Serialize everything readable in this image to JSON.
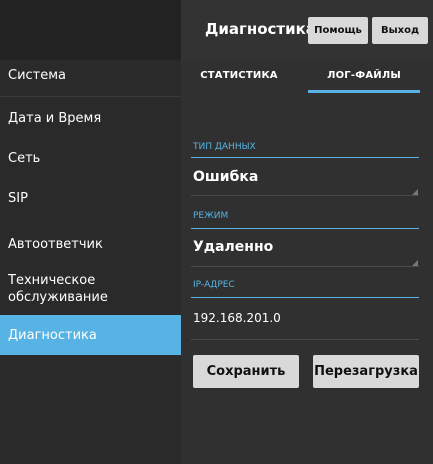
{
  "header": {
    "title": "Диагностика",
    "help_label": "Помощь",
    "exit_label": "Выход"
  },
  "sidebar": {
    "items": [
      {
        "label": "Система"
      },
      {
        "label": "Дата и Время"
      },
      {
        "label": "Сеть"
      },
      {
        "label": "SIP"
      },
      {
        "label": "Автоответчик"
      },
      {
        "label": "Техническое обслуживание"
      },
      {
        "label": "Диагностика",
        "selected": true
      }
    ]
  },
  "tabs": [
    {
      "label": "СТАТИСТИКА"
    },
    {
      "label": "ЛОГ-ФАЙЛЫ",
      "active": true
    }
  ],
  "form": {
    "data_type": {
      "label": "ТИП ДАННЫХ",
      "value": "Ошибка"
    },
    "mode": {
      "label": "РЕЖИМ",
      "value": "Удаленно"
    },
    "ip": {
      "label": "IP-АДРЕС",
      "value": "192.168.201.0"
    }
  },
  "actions": {
    "save_label": "Сохранить",
    "reboot_label": "Перезагрузка"
  },
  "colors": {
    "accent": "#56b3e3",
    "background": "#1a1a1a",
    "panel": "#303030",
    "button": "#d9d9d9"
  }
}
